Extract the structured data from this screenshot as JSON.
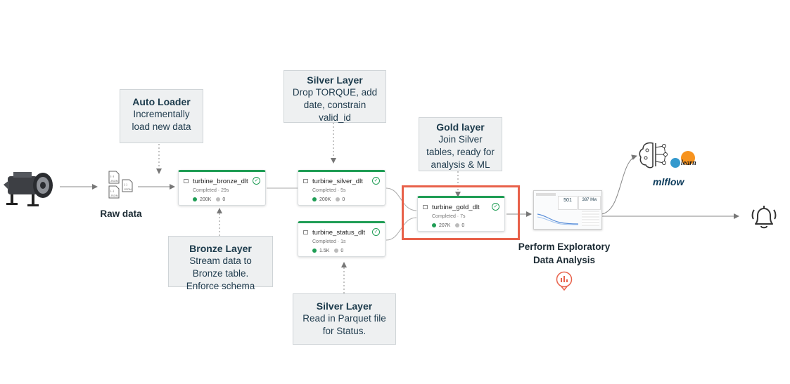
{
  "raw_data_label": "Raw data",
  "callouts": {
    "auto_loader": {
      "title": "Auto Loader",
      "body": "Incrementally\nload new data"
    },
    "bronze": {
      "title": "Bronze Layer",
      "body": "Stream data to\nBronze table.\nEnforce schema"
    },
    "silver_top": {
      "title": "Silver Layer",
      "body": "Drop TORQUE, add\ndate, constrain\nvalid_id"
    },
    "silver_bottom": {
      "title": "Silver Layer",
      "body": "Read in Parquet file\nfor Status."
    },
    "gold": {
      "title": "Gold layer",
      "body": "Join Silver\ntables, ready for\nanalysis & ML"
    }
  },
  "nodes": {
    "bronze": {
      "name": "turbine_bronze_dlt",
      "status": "Completed · 29s",
      "rows": "200K",
      "dropped": "0"
    },
    "silver": {
      "name": "turbine_silver_dlt",
      "status": "Completed · 5s",
      "rows": "200K",
      "dropped": "0"
    },
    "status": {
      "name": "turbine_status_dlt",
      "status": "Completed · 1s",
      "rows": "1.5K",
      "dropped": "0"
    },
    "gold": {
      "name": "turbine_gold_dlt",
      "status": "Completed · 7s",
      "rows": "207K",
      "dropped": "0"
    }
  },
  "eda_label": "Perform Exploratory\nData Analysis",
  "dashboard": {
    "kpi1": "501",
    "kpi2": "387 Mw"
  },
  "mlflow_label": "mlflow",
  "sklearn_label": "learn",
  "colors": {
    "highlight": "#e8614a",
    "success": "#1f9d55",
    "callout_bg": "#eef0f1"
  },
  "icons": [
    "turbine-icon",
    "files-icon",
    "brain-icon",
    "bell-icon",
    "chart-bubble-icon"
  ]
}
